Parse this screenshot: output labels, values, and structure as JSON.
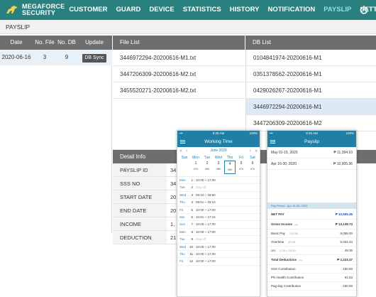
{
  "app": {
    "logo_text_1": "MEGAFORCE",
    "logo_text_2": "SECURITY",
    "nav": [
      "CUSTOMER",
      "GUARD",
      "DEVICE",
      "STATISTICS",
      "HISTORY",
      "NOTIFICATION",
      "PAYSLIP",
      "SETTING"
    ],
    "active_nav": "PAYSLIP",
    "power_icon": "power-icon",
    "accent_color": "#2a7f7f"
  },
  "page": {
    "title": "PAYSLIP"
  },
  "summary": {
    "headers": [
      "Date",
      "No. File",
      "No. DB",
      "Update"
    ],
    "row": {
      "date": "2020-06-16",
      "files": "3",
      "db": "9",
      "update_label": "DB Sync"
    }
  },
  "file_list": {
    "header": "File List",
    "items": [
      "3446972294-20200616-M1.txt",
      "3447206309-20200616-M2.txt",
      "3455520271-20200616-M2.txt"
    ]
  },
  "db_list": {
    "header": "DB List",
    "items": [
      "0104841974-20200616-M1",
      "0351378562-20200616-M1",
      "0429026267-20200616-M1",
      "3446972294-20200616-M1",
      "3447206309-20200616-M2"
    ],
    "selected_index": 3
  },
  "detail": {
    "header": "Detail Info",
    "rows": [
      {
        "key": "PAYSLIP ID",
        "value": "34"
      },
      {
        "key": "SSS NO",
        "value": "34"
      },
      {
        "key": "START DATE",
        "value": "20"
      },
      {
        "key": "END DATE",
        "value": "20"
      },
      {
        "key": "INCOME",
        "value": "1,"
      },
      {
        "key": "DEDUCTION",
        "value": "21"
      }
    ]
  },
  "phone_working_time": {
    "status_left": "•••",
    "status_time": "8:25 AM",
    "status_right": "100%",
    "title": "Working Time",
    "month": "June 2020",
    "weekdays": [
      "Sun",
      "Mon",
      "Tue",
      "Wed",
      "Thu",
      "Fri",
      "Sat"
    ],
    "dates": [
      {
        "d": "",
        "sub": ""
      },
      {
        "d": "1",
        "sub": "07h"
      },
      {
        "d": "2",
        "sub": "09h"
      },
      {
        "d": "3",
        "sub": "08h"
      },
      {
        "d": "4",
        "sub": "08h"
      },
      {
        "d": "5",
        "sub": "07h"
      },
      {
        "d": "6",
        "sub": "07h"
      }
    ],
    "rows": [
      {
        "wd": "Mon",
        "n": "1",
        "t": "10:00 ~ 17:00",
        "off": false
      },
      {
        "wd": "Tue",
        "n": "2",
        "t": "Day off",
        "off": true
      },
      {
        "wd": "Wed",
        "n": "3",
        "t": "09:34 ~ 18:50",
        "off": false
      },
      {
        "wd": "Thu",
        "n": "4",
        "t": "09:51 ~ 18:10",
        "off": false
      },
      {
        "wd": "Fri",
        "n": "5",
        "t": "10:00 ~ 17:00",
        "off": false
      },
      {
        "wd": "Sat",
        "n": "6",
        "t": "10:01 ~ 17:15",
        "off": false
      },
      {
        "wd": "Sun",
        "n": "7",
        "t": "10:00 ~ 17:00",
        "off": false
      },
      {
        "wd": "Mon",
        "n": "8",
        "t": "10:00 ~ 17:00",
        "off": false
      },
      {
        "wd": "Tue",
        "n": "9",
        "t": "Day off",
        "off": true
      },
      {
        "wd": "Wed",
        "n": "10",
        "t": "10:00 ~ 17:00",
        "off": false
      },
      {
        "wd": "Thu",
        "n": "11",
        "t": "10:00 ~ 17:00",
        "off": false
      },
      {
        "wd": "Fri",
        "n": "12",
        "t": "10:00 ~ 17:00",
        "off": false
      }
    ]
  },
  "phone_payslip": {
    "status_left": "•••",
    "status_time": "8:25 AM",
    "status_right": "100%",
    "title": "Payslip",
    "periods": [
      {
        "label": "May 01-15, 2020",
        "amount": "₱ 11,394.10"
      },
      {
        "label": "Apr 16-30, 2020",
        "amount": "₱ 10,905.36"
      }
    ],
    "band": "Pay Period : Apr 16-30, 2020",
    "net_pay_label": "NET PAY",
    "net_pay": "₱ 10,905.36",
    "gross_label": "Gross Income",
    "gross": "₱ 13,138.73",
    "basic_label": "Basic Pay",
    "basic_mid": "120.00",
    "basic": "8,055.00",
    "overtime_label": "Overtime",
    "overtime_mid": "40.05",
    "overtime": "5,034.34",
    "ua_label": "UA",
    "ua_mid": "3.29 × 15.00",
    "ua": "49.35",
    "ded_label": "Total Deductions",
    "ded": "₱ 2,233.37",
    "sss_label": "SSS Contribution",
    "sss": "150.00",
    "phil_label": "Phi Health Contribution",
    "phil": "91.63",
    "pagibig_label": "Pag-ibig Contribution",
    "pagibig": "100.00"
  }
}
